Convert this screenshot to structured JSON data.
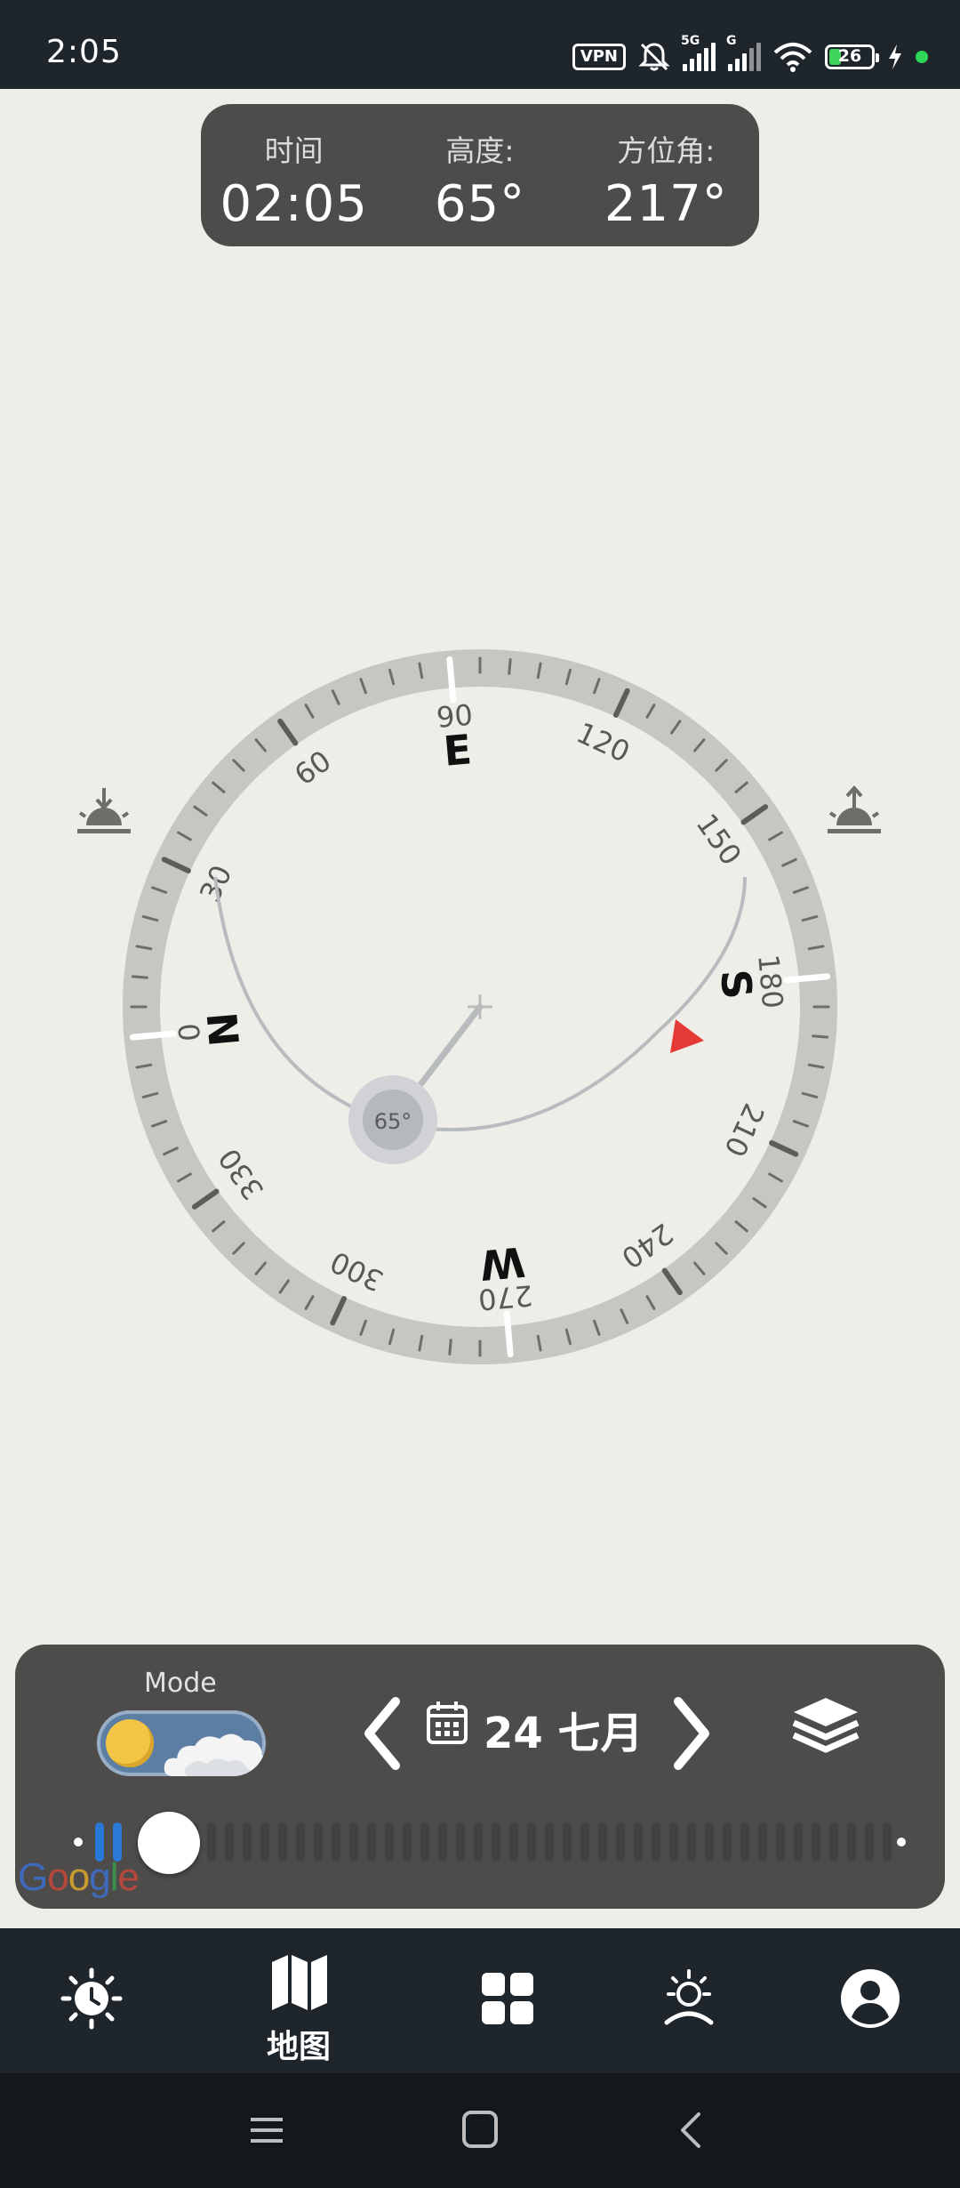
{
  "status_bar": {
    "time": "2:05",
    "vpn": "VPN",
    "network1": "5G",
    "network2": "G",
    "battery": "26"
  },
  "info_card": {
    "time_label": "时间",
    "time_value": "02:05",
    "altitude_label": "高度:",
    "altitude_value": "65°",
    "azimuth_label": "方位角:",
    "azimuth_value": "217°"
  },
  "compass": {
    "degree_labels": [
      "0",
      "30",
      "60",
      "90",
      "120",
      "150",
      "180",
      "210",
      "240",
      "270",
      "300",
      "330"
    ],
    "cardinals": {
      "north": "N",
      "east": "E",
      "south": "S",
      "west": "W"
    },
    "sun_altitude": "65°",
    "heading_rotation_deg": -95,
    "sun_azimuth_deg": 217
  },
  "panel": {
    "mode_label": "Mode",
    "date": "24 七月",
    "google": [
      "G",
      "o",
      "o",
      "g",
      "l",
      "e"
    ],
    "time_progress": 0.07
  },
  "bottom_nav": {
    "items": [
      {
        "name": "sun-time",
        "label": ""
      },
      {
        "name": "map",
        "label": "地图"
      },
      {
        "name": "apps",
        "label": ""
      },
      {
        "name": "sun-position",
        "label": ""
      },
      {
        "name": "profile",
        "label": ""
      }
    ]
  },
  "colors": {
    "background": "#efede7",
    "dark_card": "#4e4c4a",
    "ring": "#c8c6c1",
    "accent_red": "#e53935",
    "nav_bar": "#1e262c"
  }
}
